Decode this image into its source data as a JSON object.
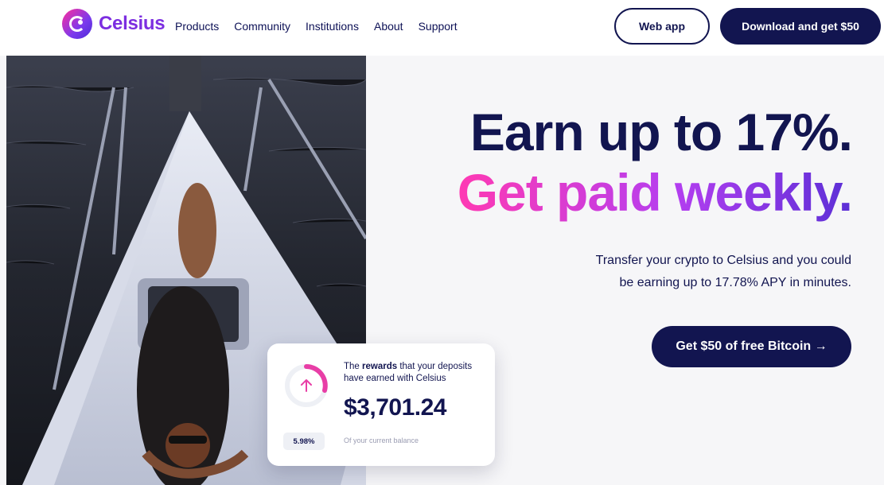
{
  "brand": {
    "name": "Celsius",
    "accent": "#7c2ee0",
    "navy": "#121550",
    "pink": "#ff3ab3"
  },
  "nav": {
    "menu": [
      "Products",
      "Community",
      "Institutions",
      "About",
      "Support"
    ],
    "web_app_label": "Web app",
    "download_label": "Download and get $50"
  },
  "hero": {
    "headline_line1": "Earn up to 17%.",
    "headline_line2": "Get paid weekly.",
    "subtext_line1": "Transfer your crypto to Celsius and you could",
    "subtext_line2": "be earning up to 17.78% APY in minutes.",
    "cta_label": "Get $50 of free Bitcoin →"
  },
  "rewards_card": {
    "text_prefix": "The ",
    "text_bold": "rewards",
    "text_suffix": " that your deposits have earned with Celsius",
    "amount": "$3,701.24",
    "percent": "5.98%",
    "percent_label": "Of your current balance",
    "icon": "arrow-up-icon"
  }
}
